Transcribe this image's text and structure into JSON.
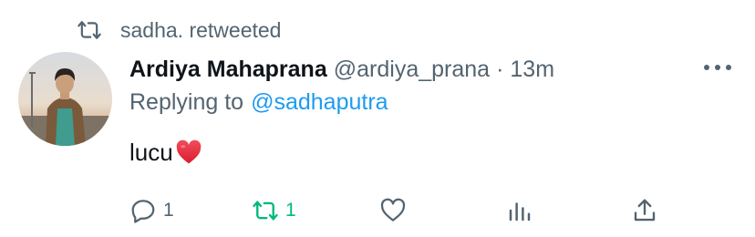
{
  "retweet_banner": {
    "text": "sadha. retweeted",
    "icon": "retweet-icon"
  },
  "tweet": {
    "author_name": "Ardiya Mahaprana",
    "author_handle": "@ardiya_prana",
    "separator": "·",
    "timestamp": "13m",
    "replying_prefix": "Replying to",
    "replying_to": "@sadhaputra",
    "text": "lucu",
    "emoji": "red-heart"
  },
  "actions": {
    "reply": {
      "icon": "reply-icon",
      "count": "1"
    },
    "retweet": {
      "icon": "retweet-icon",
      "count": "1",
      "active": true
    },
    "like": {
      "icon": "heart-icon",
      "count": ""
    },
    "analytics": {
      "icon": "analytics-icon"
    },
    "share": {
      "icon": "share-icon"
    }
  },
  "colors": {
    "secondary_text": "#536471",
    "link": "#1d9bf0",
    "retweet_active": "#00ba7c",
    "emoji_heart": "#e0243c"
  }
}
